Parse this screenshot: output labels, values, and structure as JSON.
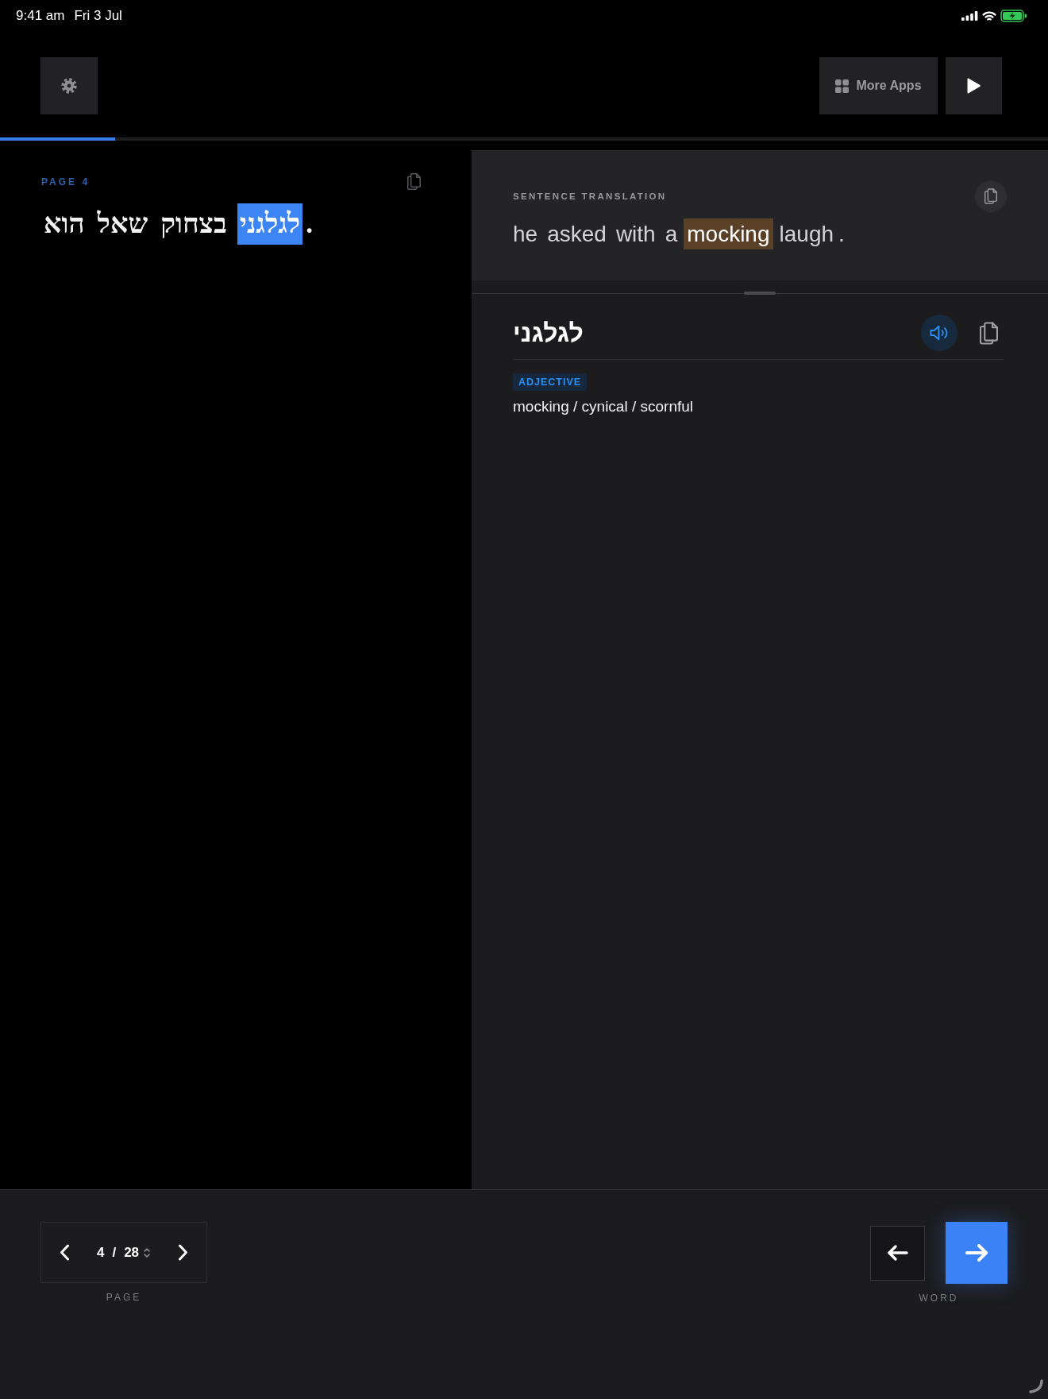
{
  "status_bar": {
    "time": "9:41 am",
    "date": "Fri 3 Jul"
  },
  "toolbar": {
    "more_apps_label": "More Apps"
  },
  "progress": {
    "level": 0.11
  },
  "source_panel": {
    "page_label": "PAGE 4",
    "tokens": [
      {
        "text": ".",
        "kind": "punctuation",
        "selected": false
      },
      {
        "text": "לגלגני",
        "kind": "word",
        "selected": true
      },
      {
        "text": "בצחוק",
        "kind": "word",
        "selected": false
      },
      {
        "text": "שאל",
        "kind": "word",
        "selected": false
      },
      {
        "text": "הוא",
        "kind": "word",
        "selected": false
      }
    ]
  },
  "translation": {
    "heading": "SENTENCE TRANSLATION",
    "tokens": [
      {
        "text": "he",
        "kind": "word",
        "selected": false
      },
      {
        "text": "asked",
        "kind": "word",
        "selected": false
      },
      {
        "text": "with",
        "kind": "word",
        "selected": false
      },
      {
        "text": "a",
        "kind": "word",
        "selected": false
      },
      {
        "text": "mocking",
        "kind": "word",
        "selected": true
      },
      {
        "text": "laugh",
        "kind": "word",
        "selected": false
      },
      {
        "text": ".",
        "kind": "punctuation",
        "selected": false
      }
    ]
  },
  "word": {
    "headword": "לגלגני",
    "part_of_speech": "ADJECTIVE",
    "definition": "mocking / cynical / scornful"
  },
  "page_nav": {
    "current": "4",
    "separator": "/",
    "total": "28",
    "label": "PAGE"
  },
  "word_nav": {
    "label": "WORD",
    "next_active": true
  }
}
